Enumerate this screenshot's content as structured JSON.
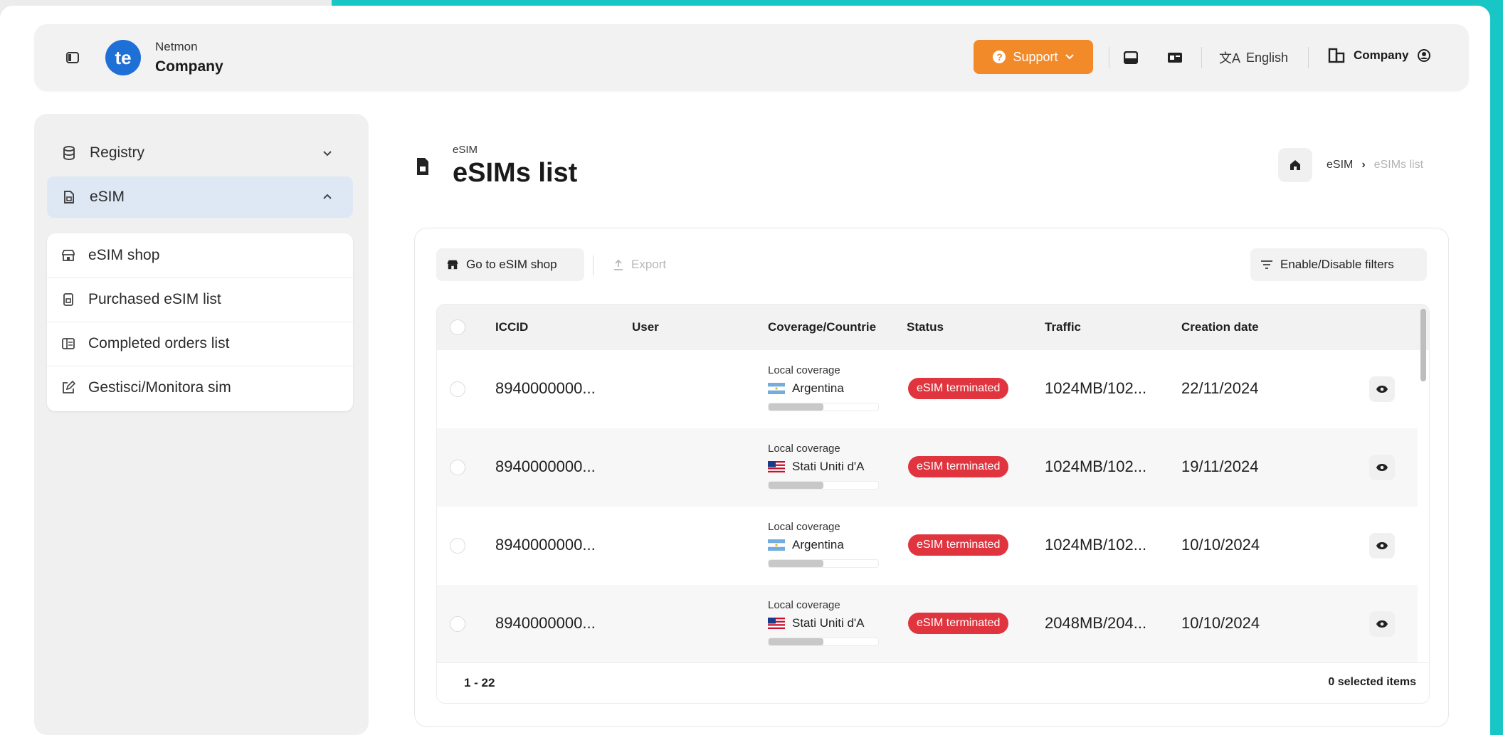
{
  "header": {
    "brand_sub": "Netmon",
    "brand_main": "Company",
    "logo_text": "te",
    "support_label": "Support",
    "language_label": "English",
    "company_label": "Company",
    "accent_color": "#f28a2a",
    "logo_color": "#1e6fd6"
  },
  "sidebar": {
    "items": [
      {
        "label": "Registry",
        "icon": "database-icon",
        "expanded": false
      },
      {
        "label": "eSIM",
        "icon": "sim-card-icon",
        "expanded": true,
        "active": true
      }
    ],
    "submenu": [
      {
        "label": "eSIM shop",
        "icon": "shop-icon"
      },
      {
        "label": "Purchased eSIM list",
        "icon": "document-icon"
      },
      {
        "label": "Completed orders list",
        "icon": "orders-icon"
      },
      {
        "label": "Gestisci/Monitora sim",
        "icon": "edit-icon"
      }
    ]
  },
  "page": {
    "kicker": "eSIM",
    "title": "eSIMs list"
  },
  "breadcrumb": {
    "items": [
      "eSIM",
      "eSIMs list"
    ]
  },
  "toolbar": {
    "go_shop_label": "Go to eSIM shop",
    "export_label": "Export",
    "filters_label": "Enable/Disable filters"
  },
  "table": {
    "columns": [
      "ICCID",
      "User",
      "Coverage/Countrie",
      "Status",
      "Traffic",
      "Creation date"
    ],
    "rows": [
      {
        "iccid": "8940000000...",
        "user": "",
        "coverage_type": "Local coverage",
        "country": "Argentina",
        "flag": "ar",
        "usage": 0.5,
        "status": "eSIM terminated",
        "traffic": "1024MB/102...",
        "date": "22/11/2024"
      },
      {
        "iccid": "8940000000...",
        "user": "",
        "coverage_type": "Local coverage",
        "country": "Stati Uniti d'A",
        "flag": "us",
        "usage": 0.5,
        "status": "eSIM terminated",
        "traffic": "1024MB/102...",
        "date": "19/11/2024"
      },
      {
        "iccid": "8940000000...",
        "user": "",
        "coverage_type": "Local coverage",
        "country": "Argentina",
        "flag": "ar",
        "usage": 0.5,
        "status": "eSIM terminated",
        "traffic": "1024MB/102...",
        "date": "10/10/2024"
      },
      {
        "iccid": "8940000000...",
        "user": "",
        "coverage_type": "Local coverage",
        "country": "Stati Uniti d'A",
        "flag": "us",
        "usage": 0.5,
        "status": "eSIM terminated",
        "traffic": "2048MB/204...",
        "date": "10/10/2024"
      }
    ],
    "range": "1 - 22",
    "selected": "0 selected items",
    "status_color": "#e0343e"
  }
}
